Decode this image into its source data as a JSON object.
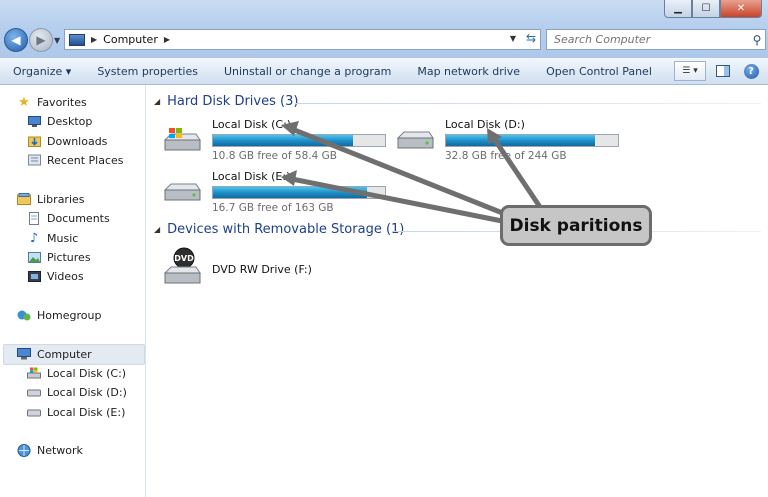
{
  "window": {
    "caption_min": "▁",
    "caption_max": "☐",
    "caption_close": "✕"
  },
  "address": {
    "path": "Computer",
    "search_placeholder": "Search Computer"
  },
  "toolbar": {
    "items": [
      "Organize ▾",
      "System properties",
      "Uninstall or change a program",
      "Map network drive",
      "Open Control Panel"
    ],
    "help_label": "?"
  },
  "navpane": {
    "favorites": "Favorites",
    "desktop": "Desktop",
    "downloads": "Downloads",
    "recent": "Recent Places",
    "libraries": "Libraries",
    "documents": "Documents",
    "music": "Music",
    "pictures": "Pictures",
    "videos": "Videos",
    "homegroup": "Homegroup",
    "computer": "Computer",
    "disk_c": "Local Disk (C:)",
    "disk_d": "Local Disk (D:)",
    "disk_e": "Local Disk (E:)",
    "network": "Network"
  },
  "content": {
    "hdd_header": "Hard Disk Drives (3)",
    "removable_header": "Devices with Removable Storage (1)",
    "drives": [
      {
        "name": "Local Disk (C:)",
        "free": "10.8 GB free of 58.4 GB",
        "used_fraction": 0.815
      },
      {
        "name": "Local Disk (D:)",
        "free": "32.8 GB free of 244 GB",
        "used_fraction": 0.866
      },
      {
        "name": "Local Disk (E:)",
        "free": "16.7 GB free of 163 GB",
        "used_fraction": 0.898
      }
    ],
    "dvd": {
      "name": "DVD RW Drive (F:)",
      "icon_text": "DVD"
    }
  },
  "callout": {
    "text": "Disk paritions"
  },
  "colors": {
    "accent": "#1e3f8a",
    "bar_fill": "#1c8bc5",
    "callout_bg": "#c6c6c6",
    "callout_border": "#6c6c6c"
  }
}
